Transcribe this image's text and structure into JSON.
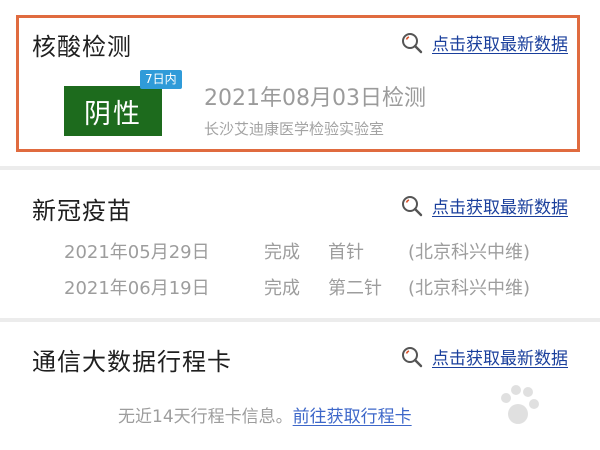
{
  "fetch_label": "点击获取最新数据",
  "nucleic": {
    "title": "核酸检测",
    "result": "阴性",
    "validity": "7日内",
    "date": "2021年08月03日检测",
    "lab": "长沙艾迪康医学检验实验室",
    "result_color": "#1d6b1d"
  },
  "vaccine": {
    "title": "新冠疫苗",
    "doses": [
      {
        "date": "2021年05月29日",
        "status": "完成",
        "dose": "首针",
        "maker": "(北京科兴中维)"
      },
      {
        "date": "2021年06月19日",
        "status": "完成",
        "dose": "第二针",
        "maker": "(北京科兴中维)"
      }
    ]
  },
  "trip": {
    "title": "通信大数据行程卡",
    "info": "无近14天行程卡信息。",
    "link": "前往获取行程卡"
  },
  "colors": {
    "link": "#1a3f9c",
    "highlight": "#e06b3f",
    "tag": "#2f9bd9"
  },
  "icons": {
    "fetch": "magnifier-icon"
  }
}
